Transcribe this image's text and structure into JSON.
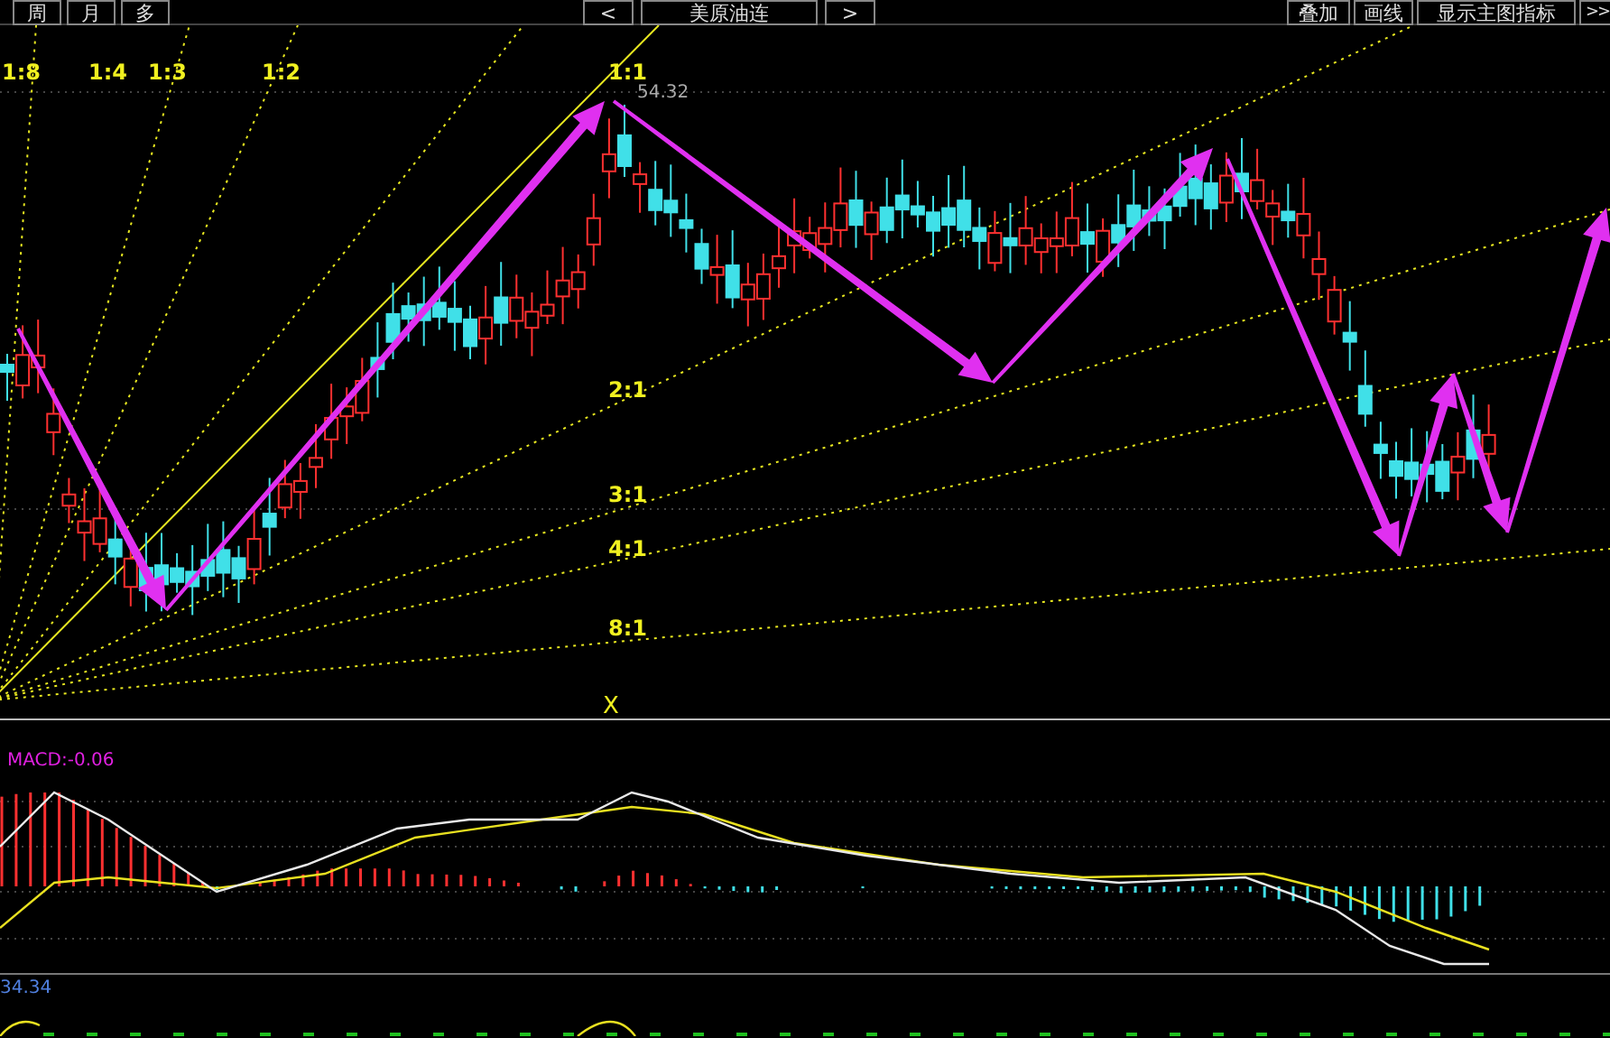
{
  "toolbar_left": [
    {
      "label": "周"
    },
    {
      "label": "月"
    },
    {
      "label": "多"
    }
  ],
  "symbol_nav": {
    "prev": "<",
    "title": "美原油连",
    "next": ">"
  },
  "toolbar_right": [
    {
      "label": "叠加"
    },
    {
      "label": "画线"
    },
    {
      "label": "显示主图指标"
    },
    {
      "label": ">>"
    }
  ],
  "main_chart": {
    "fan_labels": [
      "1:8",
      "1:4",
      "1:3",
      "1:2",
      "1:1",
      "2:1",
      "3:1",
      "4:1",
      "8:1"
    ],
    "price_marker": "54.32",
    "origin_mark": "X"
  },
  "macd_panel": {
    "label": "MACD:-0.06"
  },
  "lower_panel": {
    "value": "34.34"
  }
}
